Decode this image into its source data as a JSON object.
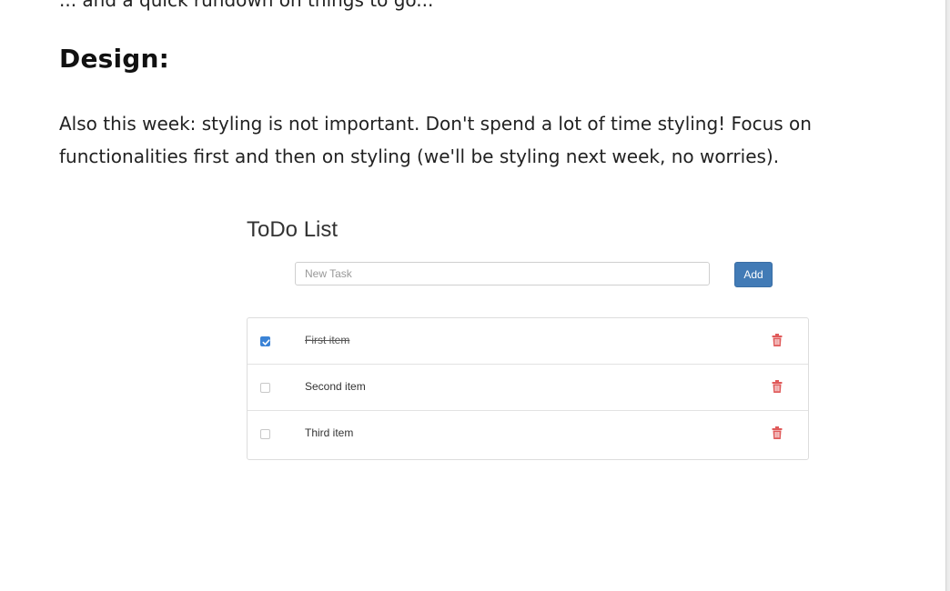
{
  "article": {
    "top_cut_text": "... and a quick rundown on things to go...",
    "heading": "Design:",
    "paragraph": "Also this week: styling is not important. Don't spend a lot of time styling! Focus on functionalities first and then on styling (we'll be styling next week, no worries)."
  },
  "todo": {
    "title": "ToDo List",
    "input_placeholder": "New Task",
    "input_value": "",
    "add_label": "Add",
    "items": [
      {
        "label": "First item",
        "done": true
      },
      {
        "label": "Second item",
        "done": false
      },
      {
        "label": "Third item",
        "done": false
      }
    ],
    "colors": {
      "accent": "#427bb6",
      "checkbox_checked": "#3b83d6",
      "trash": "#e05a5a"
    },
    "icons": {
      "delete": "trash-icon",
      "check": "checkmark-icon"
    }
  }
}
